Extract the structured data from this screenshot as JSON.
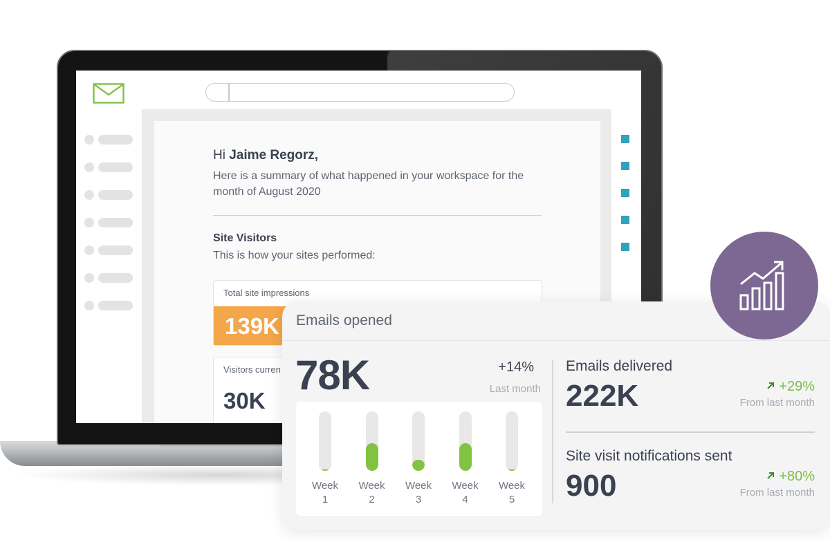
{
  "email": {
    "greeting_prefix": "Hi ",
    "recipient_name": "Jaime Regorz,",
    "intro": "Here is a summary of what happened in your workspace for the month of August 2020",
    "section_title": "Site Visitors",
    "section_subtitle": "This is how your sites performed:",
    "stat1_label": "Total site impressions",
    "stat1_value": "139K",
    "stat2_label": "Visitors curren",
    "stat2_value": "30K"
  },
  "colors": {
    "accent_orange": "#f3a64a",
    "accent_green": "#82c342",
    "rail_teal": "#2ea3bf",
    "badge_purple": "#7c6892"
  },
  "icons": [
    "mail-icon",
    "bar-chart-growth-icon",
    "trend-up-arrow-icon"
  ],
  "card": {
    "title": "Emails opened",
    "big_value": "78K",
    "change": "+14%",
    "change_label": "Last month",
    "metrics": [
      {
        "title": "Emails delivered",
        "value": "222K",
        "change": "+29%",
        "sub": "From last month"
      },
      {
        "title": "Site visit notifications sent",
        "value": "900",
        "change": "+80%",
        "sub": "From last month"
      }
    ]
  },
  "chart_data": {
    "type": "bar",
    "categories": [
      [
        "Week",
        "1"
      ],
      [
        "Week",
        "2"
      ],
      [
        "Week",
        "3"
      ],
      [
        "Week",
        "4"
      ],
      [
        "Week",
        "5"
      ]
    ],
    "values": [
      0.02,
      0.47,
      0.19,
      0.47,
      0.02
    ],
    "ylim": [
      0,
      1
    ],
    "grid": false
  }
}
